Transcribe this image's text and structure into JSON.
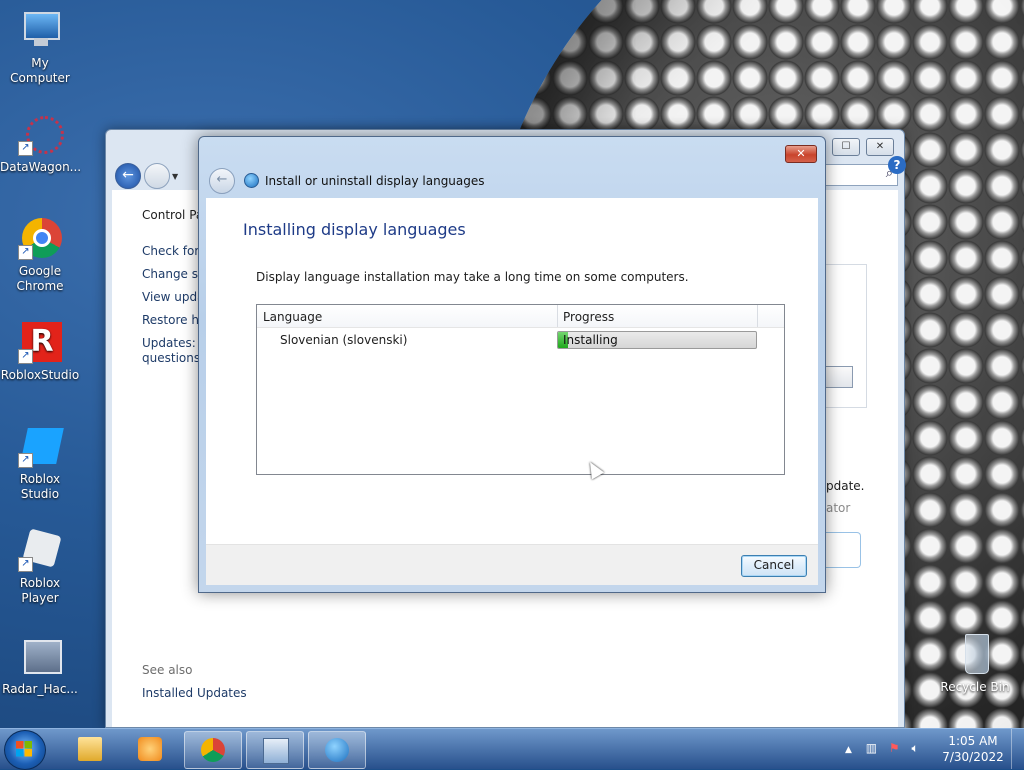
{
  "desktop": {
    "icons": [
      {
        "label": "My Computer"
      },
      {
        "label": "DataWagon..."
      },
      {
        "label": "Google Chrome"
      },
      {
        "label": "RobloxStudio"
      },
      {
        "label": "Roblox Studio"
      },
      {
        "label": "Roblox Player"
      },
      {
        "label": "Radar_Hac..."
      },
      {
        "label": "Recycle Bin"
      }
    ]
  },
  "control_panel": {
    "breadcrumb": "Control Pa",
    "links": [
      "Check for u",
      "Change se",
      "View updat",
      "Restore hic",
      "Updates: fr",
      "questions"
    ],
    "see_also": "See also",
    "installed_updates": "Installed Updates",
    "right_fragments": [
      "n",
      "pdate.",
      "ator"
    ]
  },
  "dialog": {
    "title": "Install or uninstall display languages",
    "close_label": "✕",
    "heading": "Installing display languages",
    "description": "Display language installation may take a long time on some computers.",
    "columns": {
      "language": "Language",
      "progress": "Progress"
    },
    "rows": [
      {
        "language": "Slovenian (slovenski)",
        "status": "Installing",
        "progress": 0.05
      }
    ],
    "cancel_label": "Cancel"
  },
  "taskbar": {
    "clock_time": "1:05 AM",
    "clock_date": "7/30/2022",
    "tray_arrow": "▲"
  },
  "colors": {
    "heading": "#1e3b87",
    "progress_fill": "#1fa81c",
    "close_red": "#c9442c"
  }
}
